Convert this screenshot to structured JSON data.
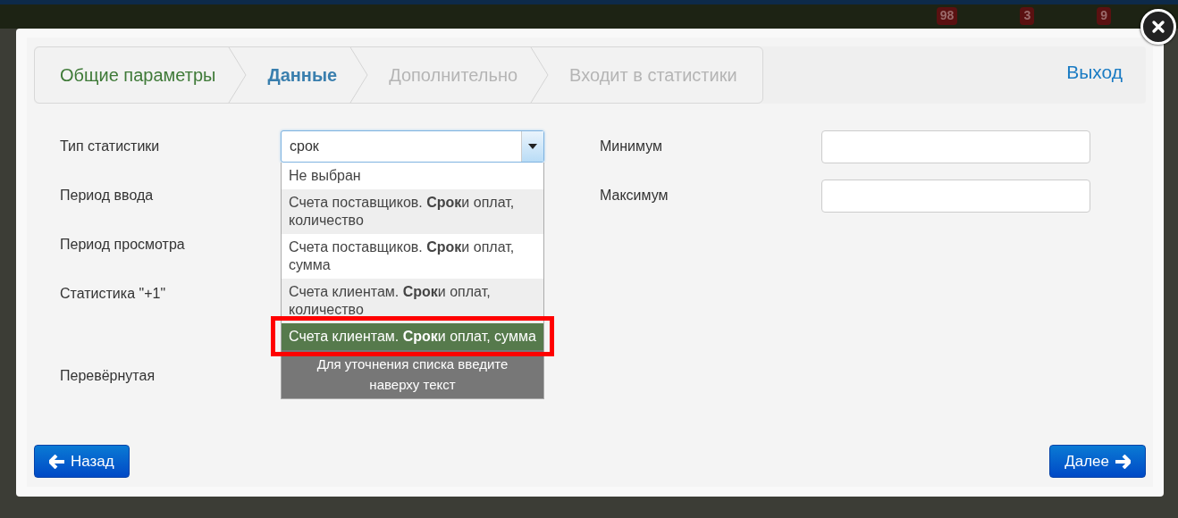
{
  "top_badges": [
    "98",
    "3",
    "9"
  ],
  "steps": [
    {
      "label": "Общие параметры",
      "done": true,
      "selected": false
    },
    {
      "label": "Данные",
      "done": false,
      "selected": true
    },
    {
      "label": "Дополнительно",
      "done": false,
      "selected": false
    },
    {
      "label": "Входит в статистики",
      "done": false,
      "selected": false
    }
  ],
  "exit_link": "Выход",
  "form": {
    "labels": [
      "Тип статистики",
      "Период ввода",
      "Период просмотра",
      "Статистика \"+1\"",
      "Перевёрнутая"
    ],
    "type_select": {
      "value": "срок",
      "expanded": true,
      "options": [
        {
          "text": "Не выбран",
          "selected": false
        },
        {
          "text": "Счета поставщиков. **Срок**и оплат, количество",
          "selected": false
        },
        {
          "text": "Счета поставщиков. **Срок**и оплат, сумма",
          "selected": false
        },
        {
          "text": "Счета клиентам. **Срок**и оплат, количество",
          "selected": false
        },
        {
          "text": "Счета клиентам. **Срок**и оплат, сумма",
          "selected": true
        }
      ],
      "hint": "Для уточнения списка введите наверху текст"
    },
    "right_fields": [
      {
        "label": "Минимум"
      },
      {
        "label": "Максимум"
      }
    ]
  },
  "highlight_selected": true,
  "buttons": {
    "back": "Назад",
    "next": "Далее"
  }
}
